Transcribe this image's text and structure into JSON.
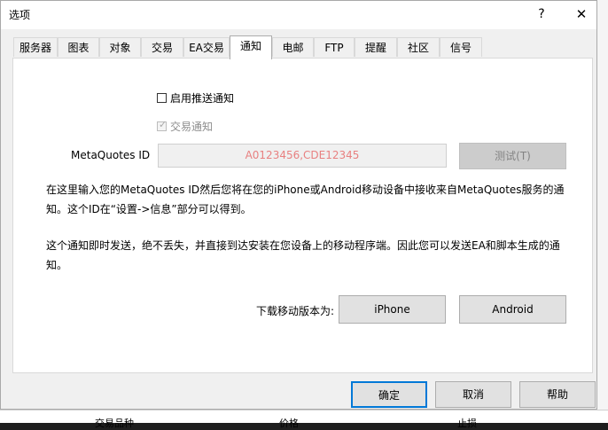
{
  "window": {
    "title": "选项",
    "help_glyph": "?",
    "close_glyph": "✕"
  },
  "tabs": [
    {
      "label": "服务器"
    },
    {
      "label": "图表"
    },
    {
      "label": "对象"
    },
    {
      "label": "交易"
    },
    {
      "label": "EA交易"
    },
    {
      "label": "通知",
      "active": true
    },
    {
      "label": "电邮"
    },
    {
      "label": "FTP"
    },
    {
      "label": "提醒"
    },
    {
      "label": "社区"
    },
    {
      "label": "信号"
    }
  ],
  "notify": {
    "enable_push_label": "启用推送通知",
    "enable_push_checked": false,
    "trade_notify_label": "交易通知",
    "trade_notify_checked": true,
    "metaquotes_id_label": "MetaQuotes ID",
    "metaquotes_id_placeholder": "A0123456,CDE12345",
    "test_button": "测试(T)",
    "info_text_1": "在这里输入您的MetaQuotes ID然后您将在您的iPhone或Android移动设备中接收来自MetaQuotes服务的通知。这个ID在“设置->信息”部分可以得到。",
    "info_text_2": "这个通知即时发送，绝不丢失，并直接到达安装在您设备上的移动程序端。因此您可以发送EA和脚本生成的通知。",
    "download_label": "下载移动版本为:",
    "iphone_button": "iPhone",
    "android_button": "Android"
  },
  "footer": {
    "ok": "确定",
    "cancel": "取消",
    "help": "帮助"
  },
  "background_strip": {
    "col1": "交易品种",
    "col2": "价格",
    "col3": "止损"
  }
}
